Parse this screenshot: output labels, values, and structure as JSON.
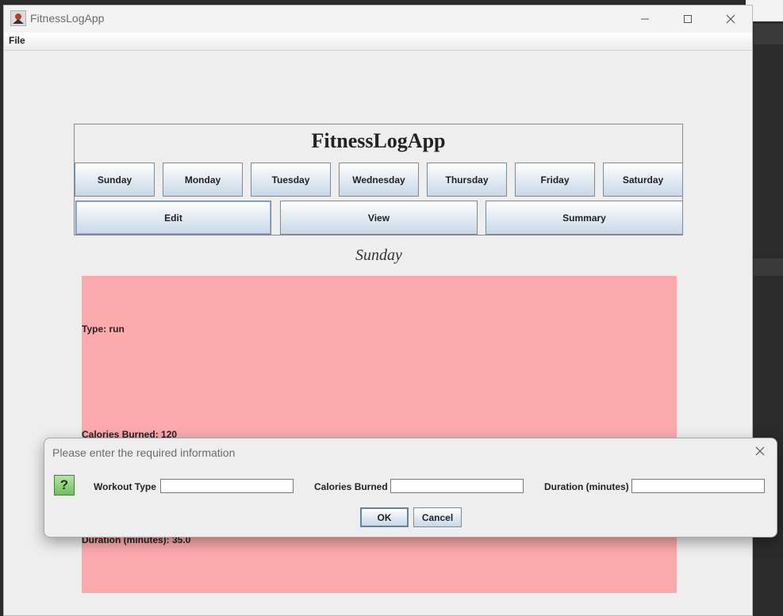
{
  "window": {
    "title": "FitnessLogApp",
    "menu": {
      "file": "File"
    }
  },
  "header": {
    "app_title": "FitnessLogApp",
    "days": [
      "Sunday",
      "Monday",
      "Tuesday",
      "Wednesday",
      "Thursday",
      "Friday",
      "Saturday"
    ],
    "actions": [
      "Edit",
      "View",
      "Summary"
    ]
  },
  "day_view": {
    "heading": "Sunday",
    "entry": {
      "type": "Type: run",
      "calories": "Calories Burned: 120",
      "duration": "Duration (minutes): 35.0"
    },
    "background_color": "#fdaaad"
  },
  "dialog": {
    "title": "Please enter the required information",
    "fields": [
      {
        "label": "Workout Type",
        "value": ""
      },
      {
        "label": "Calories Burned",
        "value": ""
      },
      {
        "label": "Duration (minutes)",
        "value": ""
      }
    ],
    "ok_label": "OK",
    "cancel_label": "Cancel",
    "icon": "question-icon"
  }
}
